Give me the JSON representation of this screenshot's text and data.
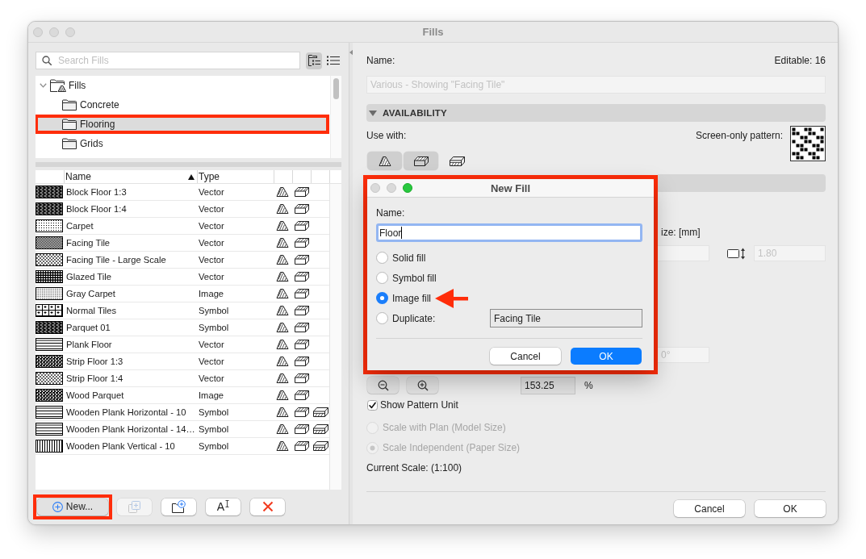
{
  "window": {
    "title": "Fills",
    "controls": [
      {
        "enabled": false
      },
      {
        "enabled": false
      },
      {
        "enabled": false
      }
    ]
  },
  "browser": {
    "search": {
      "placeholder": "Search Fills"
    },
    "views": [
      {
        "kind": "tree",
        "selected": true
      },
      {
        "kind": "list",
        "selected": false
      }
    ],
    "tree": [
      {
        "label": "Fills",
        "kind": "root",
        "expanded": true,
        "selected": false,
        "highlighted": false,
        "children": [
          {
            "label": "Concrete",
            "kind": "folder",
            "selected": false,
            "highlighted": false
          },
          {
            "label": "Flooring",
            "kind": "folder",
            "selected": true,
            "highlighted": true
          },
          {
            "label": "Grids",
            "kind": "folder",
            "selected": false,
            "highlighted": false
          }
        ]
      }
    ],
    "table": {
      "columns": [
        {
          "label": "Name",
          "sorted": true
        },
        {
          "label": "Type",
          "sorted": false
        }
      ],
      "rows": [
        {
          "kind": "block",
          "name": "Block Floor 1:3",
          "type": "Vector",
          "flat": true,
          "top_face": true,
          "front_face": false
        },
        {
          "kind": "block",
          "name": "Block Floor 1:4",
          "type": "Vector",
          "flat": true,
          "top_face": true,
          "front_face": false
        },
        {
          "kind": "dots",
          "name": "Carpet",
          "type": "Vector",
          "flat": true,
          "top_face": true,
          "front_face": false
        },
        {
          "kind": "dense",
          "name": "Facing Tile",
          "type": "Vector",
          "flat": true,
          "top_face": true,
          "front_face": false
        },
        {
          "kind": "cross",
          "name": "Facing Tile - Large Scale",
          "type": "Vector",
          "flat": true,
          "top_face": true,
          "front_face": false
        },
        {
          "kind": "grid",
          "name": "Glazed Tile",
          "type": "Vector",
          "flat": true,
          "top_face": true,
          "front_face": false
        },
        {
          "kind": "fine",
          "name": "Gray Carpet",
          "type": "Image",
          "flat": true,
          "top_face": true,
          "front_face": false
        },
        {
          "kind": "tiles",
          "name": "Normal Tiles",
          "type": "Symbol",
          "flat": true,
          "top_face": true,
          "front_face": false
        },
        {
          "kind": "block",
          "name": "Parquet 01",
          "type": "Symbol",
          "flat": true,
          "top_face": true,
          "front_face": false
        },
        {
          "kind": "planks_h",
          "name": "Plank Floor",
          "type": "Vector",
          "flat": true,
          "top_face": true,
          "front_face": false
        },
        {
          "kind": "strip",
          "name": "Strip Floor 1:3",
          "type": "Vector",
          "flat": true,
          "top_face": true,
          "front_face": false
        },
        {
          "kind": "cross",
          "name": "Strip Floor 1:4",
          "type": "Vector",
          "flat": true,
          "top_face": true,
          "front_face": false
        },
        {
          "kind": "strip",
          "name": "Wood Parquet",
          "type": "Image",
          "flat": true,
          "top_face": true,
          "front_face": false
        },
        {
          "kind": "planks_h",
          "name": "Wooden Plank Horizontal - 10",
          "type": "Symbol",
          "flat": true,
          "top_face": true,
          "front_face": true
        },
        {
          "kind": "planks_h",
          "name": "Wooden Plank Horizontal - 14…",
          "type": "Symbol",
          "flat": true,
          "top_face": true,
          "front_face": true
        },
        {
          "kind": "planks_v",
          "name": "Wooden Plank Vertical - 10",
          "type": "Symbol",
          "flat": true,
          "top_face": true,
          "front_face": true
        }
      ]
    },
    "buttons": [
      {
        "kind": "new",
        "label": "New...",
        "disabled": false,
        "pressed": true,
        "highlighted": true
      },
      {
        "kind": "duplicate",
        "disabled": true,
        "pressed": false,
        "highlighted": false
      },
      {
        "kind": "new_folder",
        "disabled": false,
        "pressed": false,
        "highlighted": false
      },
      {
        "kind": "rename",
        "label": "A",
        "disabled": false,
        "pressed": false,
        "highlighted": false
      },
      {
        "kind": "delete",
        "disabled": false,
        "pressed": false,
        "highlighted": false
      }
    ]
  },
  "settings": {
    "name_label": "Name:",
    "editable": "Editable: 16",
    "name_field": {
      "value": "Various - Showing \"Facing Tile\"",
      "disabled": true
    },
    "availability": {
      "title": "AVAILABILITY",
      "expanded": true,
      "use_with_label": "Use with:",
      "use_with": [
        {
          "kind": "flat",
          "on": true
        },
        {
          "kind": "top_face",
          "on": true
        },
        {
          "kind": "front_face",
          "on": false
        }
      ],
      "screen_pattern_label": "Screen-only pattern:"
    },
    "size_label": "ize: [mm]",
    "height_field": {
      "value": "1.80",
      "disabled": true
    },
    "angle_field": {
      "value": "0°",
      "disabled": true
    },
    "zoom_field": {
      "value": "153.25",
      "unit": "%"
    },
    "show_pattern_unit": {
      "label": "Show Pattern Unit",
      "checked": true
    },
    "scale_options": [
      {
        "label": "Scale with Plan (Model Size)",
        "selected": false,
        "disabled": true
      },
      {
        "label": "Scale Independent (Paper Size)",
        "selected": true,
        "disabled": true
      }
    ],
    "current_scale": "Current Scale: (1:100)",
    "buttons": [
      {
        "label": "Cancel",
        "default": false
      },
      {
        "label": "OK",
        "default": false
      }
    ]
  },
  "dialog": {
    "title": "New Fill",
    "highlighted": true,
    "controls": [
      {
        "enabled": false
      },
      {
        "enabled": false
      },
      {
        "enabled": true
      }
    ],
    "name_label": "Name:",
    "name_field": {
      "value": "Floor",
      "focused": true
    },
    "options": [
      {
        "label": "Solid fill",
        "selected": false,
        "arrow": false
      },
      {
        "label": "Symbol fill",
        "selected": false,
        "arrow": false
      },
      {
        "label": "Image fill",
        "selected": true,
        "arrow": true
      },
      {
        "label": "Duplicate:",
        "selected": false,
        "arrow": false,
        "source": "Facing Tile"
      }
    ],
    "buttons": [
      {
        "label": "Cancel",
        "default": false
      },
      {
        "label": "OK",
        "default": true
      }
    ]
  }
}
